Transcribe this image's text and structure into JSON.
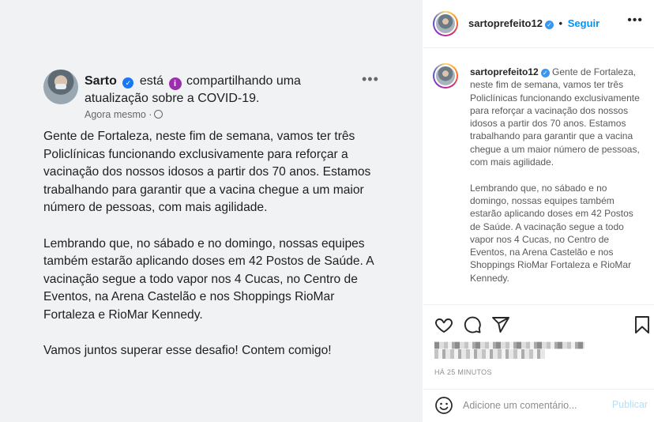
{
  "post_image": {
    "author": "Sarto",
    "status_text": "está",
    "activity": "compartilhando uma atualização sobre a COVID-19.",
    "time": "Agora mesmo ·",
    "more": "•••",
    "paragraphs": [
      "Gente de Fortaleza, neste fim de semana, vamos ter três Policlínicas funcionando exclusivamente para reforçar a vacinação dos nossos idosos a partir dos 70 anos. Estamos trabalhando para garantir que a vacina chegue a um maior número de pessoas, com mais agilidade.",
      "Lembrando que, no sábado e no domingo, nossas equipes também estarão aplicando doses em 42 Postos de Saúde. A vacinação segue a todo vapor nos 4 Cucas, no Centro de Eventos, na Arena Castelão e nos Shoppings RioMar Fortaleza e RioMar Kennedy.",
      "Vamos juntos superar esse desafio! Contem comigo!"
    ]
  },
  "header": {
    "username": "sartoprefeito12",
    "dot": "•",
    "follow": "Seguir",
    "more": "•••"
  },
  "caption": {
    "username": "sartoprefeito12",
    "paragraph1": " Gente de Fortaleza, neste fim de semana, vamos ter três Policlínicas funcionando exclusivamente para reforçar a vacinação dos nossos idosos a partir dos 70 anos. Estamos trabalhando para garantir que a vacina chegue a um maior número de pessoas, com mais agilidade.",
    "paragraph2": "Lembrando que, no sábado e no domingo, nossas equipes também estarão aplicando doses em 42 Postos de Saúde. A vacinação segue a todo vapor nos 4 Cucas, no Centro de Eventos, na Arena Castelão e nos Shoppings RioMar Fortaleza e RioMar Kennedy."
  },
  "actions": {
    "icons": [
      "heart-icon",
      "comment-icon",
      "share-icon",
      "bookmark-icon"
    ],
    "time_ago": "HÁ 25 MINUTOS"
  },
  "comment": {
    "placeholder": "Adicione um comentário...",
    "publish": "Publicar"
  },
  "colors": {
    "accent": "#0095f6",
    "publish_disabled": "#b2dffc",
    "fb_verified": "#1877f2",
    "info_badge": "#9b2fae"
  }
}
